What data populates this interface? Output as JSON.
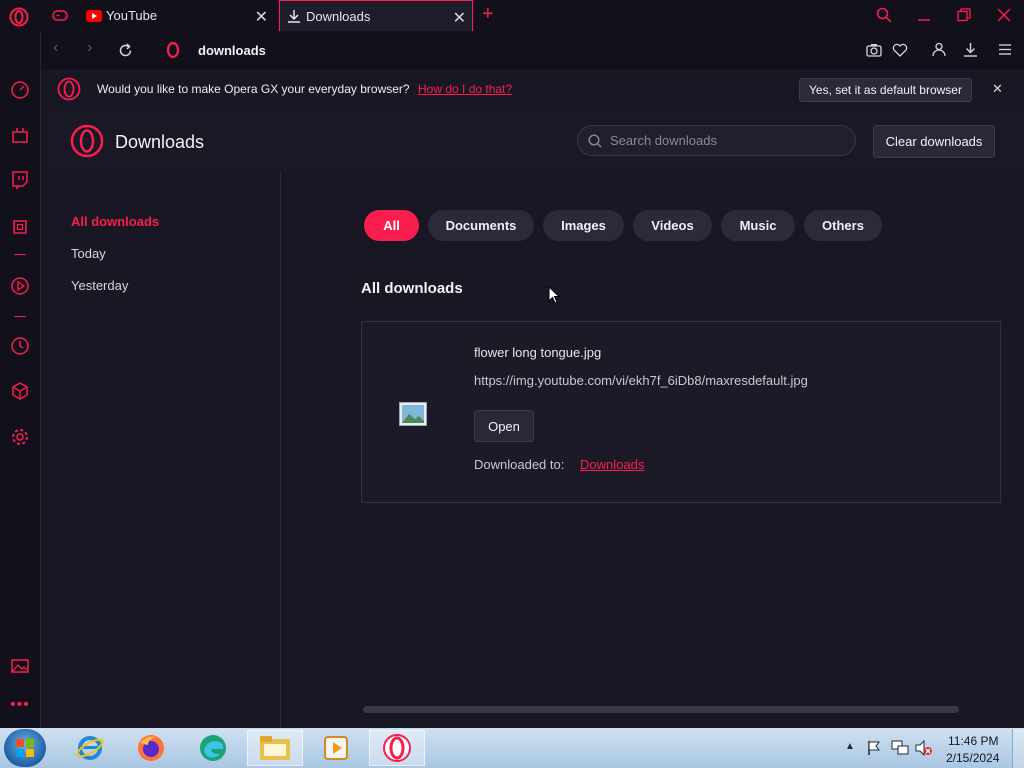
{
  "tabs": [
    {
      "label": "YouTube"
    },
    {
      "label": "Downloads"
    }
  ],
  "address": {
    "text": "downloads"
  },
  "notification": {
    "message": "Would you like to make Opera GX your everyday browser?",
    "link": "How do I do that?",
    "button": "Yes, set it as default browser"
  },
  "header": {
    "title": "Downloads",
    "search_placeholder": "Search downloads",
    "clear_button": "Clear downloads"
  },
  "nav": {
    "items": [
      {
        "label": "All downloads"
      },
      {
        "label": "Today"
      },
      {
        "label": "Yesterday"
      }
    ]
  },
  "filters": [
    "All",
    "Documents",
    "Images",
    "Videos",
    "Music",
    "Others"
  ],
  "section_title": "All downloads",
  "download": {
    "filename": "flower long tongue.jpg",
    "url": "https://img.youtube.com/vi/ekh7f_6iDb8/maxresdefault.jpg",
    "open_button": "Open",
    "downloaded_to_label": "Downloaded to:",
    "downloaded_to_link": "Downloads"
  },
  "clock": {
    "time": "11:46 PM",
    "date": "2/15/2024"
  },
  "colors": {
    "accent": "#fa1e4e",
    "background": "#1a1724",
    "taskbar": "#bcd4ec"
  }
}
